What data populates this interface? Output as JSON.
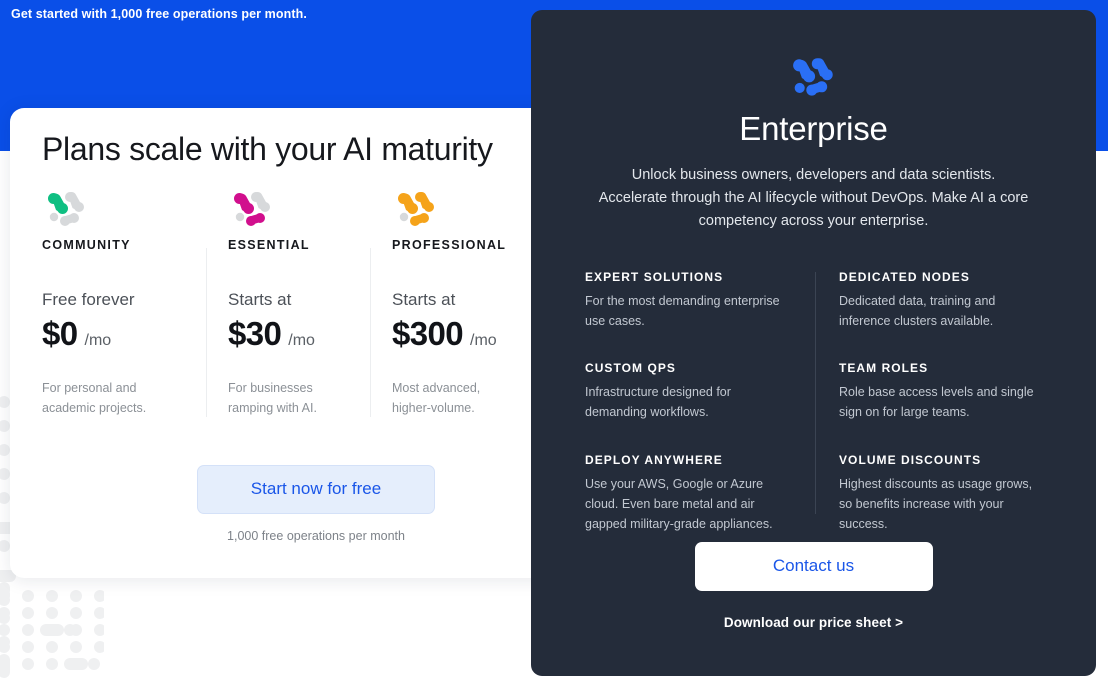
{
  "hero": {
    "eyebrow": "Get started with 1,000 free operations per month.",
    "band_color": "#0a4fe8"
  },
  "plans": {
    "title": "Plans scale with your AI maturity",
    "tiers": [
      {
        "logo_icon": "molecule-logo-icon",
        "accent": "#0fbf82",
        "name": "COMMUNITY",
        "sub": "Free forever",
        "price": "$0",
        "period": "/mo",
        "description": "For personal and academic projects."
      },
      {
        "logo_icon": "molecule-logo-icon",
        "accent": "#d10f8d",
        "name": "ESSENTIAL",
        "sub": "Starts at",
        "price": "$30",
        "period": "/mo",
        "description": "For businesses ramping with AI."
      },
      {
        "logo_icon": "molecule-logo-icon",
        "accent": "#f5a31a",
        "name": "PROFESSIONAL",
        "sub": "Starts at",
        "price": "$300",
        "period": "/mo",
        "description": "Most advanced, higher-volume."
      }
    ],
    "cta_label": "Start now for free",
    "cta_note": "1,000 free operations per month"
  },
  "enterprise": {
    "logo_icon": "molecule-logo-icon",
    "logo_color": "#2a6ff5",
    "panel_color": "#242c3a",
    "title": "Enterprise",
    "lede": "Unlock business owners, developers and data scientists. Accelerate through the AI lifecycle without DevOps. Make AI a core competency across your enterprise.",
    "features_left": [
      {
        "title": "EXPERT SOLUTIONS",
        "body": "For the most demanding enterprise use cases."
      },
      {
        "title": "CUSTOM QPS",
        "body": "Infrastructure designed for demanding workflows."
      },
      {
        "title": "DEPLOY ANYWHERE",
        "body": "Use your AWS, Google or Azure cloud. Even bare metal and air gapped military-grade appliances."
      }
    ],
    "features_right": [
      {
        "title": "DEDICATED NODES",
        "body": "Dedicated data, training and inference clusters available."
      },
      {
        "title": "TEAM ROLES",
        "body": "Role base access levels and single sign on for large teams."
      },
      {
        "title": "VOLUME DISCOUNTS",
        "body": "Highest discounts as usage grows, so benefits increase with your success."
      }
    ],
    "cta_label": "Contact us",
    "secondary_link": "Download our price sheet >"
  },
  "decoration": {
    "dot_grid_icon": "dot-grid-pattern",
    "dot_color": "#eff0f1"
  }
}
